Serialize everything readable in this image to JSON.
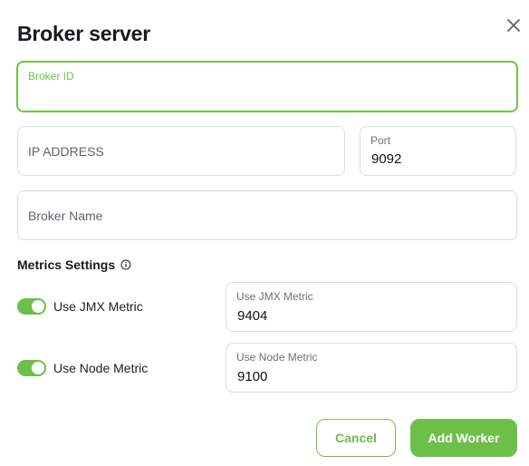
{
  "dialog": {
    "title": "Broker server",
    "close_icon": "close-icon"
  },
  "fields": {
    "broker_id": {
      "label": "Broker ID",
      "value": ""
    },
    "ip_address": {
      "placeholder": "IP ADDRESS",
      "value": ""
    },
    "port": {
      "label": "Port",
      "value": "9092"
    },
    "broker_name": {
      "placeholder": "Broker Name",
      "value": ""
    }
  },
  "metrics": {
    "section_title": "Metrics Settings",
    "info_icon": "info-icon",
    "jmx": {
      "toggle_label": "Use JMX Metric",
      "enabled": true,
      "field_label": "Use JMX Metric",
      "value": "9404"
    },
    "node": {
      "toggle_label": "Use Node Metric",
      "enabled": true,
      "field_label": "Use Node Metric",
      "value": "9100"
    }
  },
  "actions": {
    "cancel_label": "Cancel",
    "add_label": "Add Worker"
  },
  "colors": {
    "accent": "#6cc04a",
    "border": "#d9dde1",
    "text": "#171a1f"
  }
}
